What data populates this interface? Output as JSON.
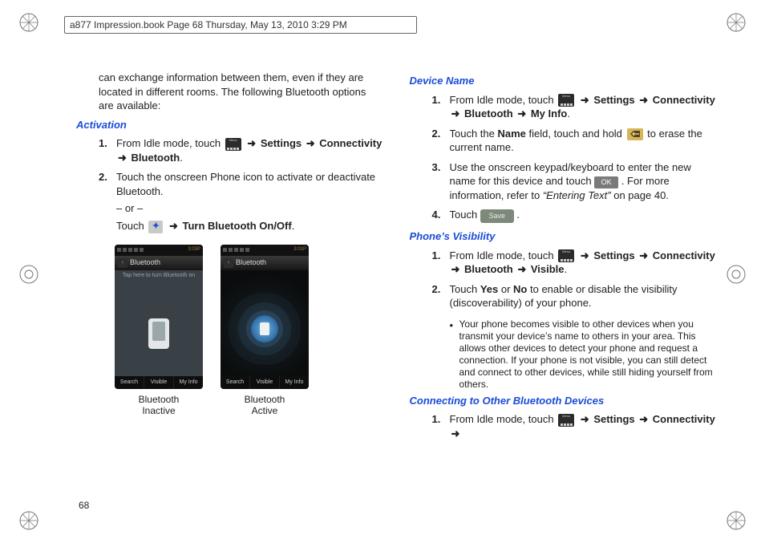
{
  "header": {
    "crop_text": "a877 Impression.book  Page 68  Thursday, May 13, 2010  3:29 PM"
  },
  "page_number": "68",
  "arrow_glyph": "➜",
  "left": {
    "intro": "can exchange information between them, even if they are located in different rooms. The following Bluetooth options are available:",
    "activation_title": "Activation",
    "act_step1_pre": "From Idle mode, touch ",
    "act_step1_seq": [
      "Settings",
      "Connectivity",
      "Bluetooth"
    ],
    "act_step2_l1": "Touch the onscreen Phone icon to activate or deactivate Bluetooth.",
    "act_step2_or": "– or –",
    "act_step2_l3_pre": "Touch ",
    "act_step2_l3_target": "Turn Bluetooth On/Off",
    "phone_status_time": "3:03P",
    "phone_status_time2": "3:01P",
    "phone_title": "Bluetooth",
    "phone_taphint": "Tap here to turn Bluetooth on",
    "softkeys": [
      "Search",
      "Visible",
      "My Info"
    ],
    "caption_inactive_l1": "Bluetooth",
    "caption_inactive_l2": "Inactive",
    "caption_active_l1": "Bluetooth",
    "caption_active_l2": "Active"
  },
  "right": {
    "devname_title": "Device Name",
    "dn_step1_pre": "From Idle mode, touch ",
    "dn_step1_seq": [
      "Settings",
      "Connectivity",
      "Bluetooth",
      "My Info"
    ],
    "dn_step2_a": "Touch the ",
    "dn_step2_name": "Name",
    "dn_step2_b": " field, touch and hold ",
    "dn_step2_c": " to erase the current name.",
    "dn_step3_a": "Use the onscreen keypad/keyboard to enter the new name for this device and touch ",
    "dn_step3_b": ". For more information, refer to ",
    "dn_step3_ref": "“Entering Text”",
    "dn_step3_c": "  on page 40.",
    "dn_step4": "Touch ",
    "ok_label": "OK",
    "save_label": "Save",
    "vis_title": "Phone’s Visibility",
    "vis_step1_pre": "From Idle mode, touch ",
    "vis_step1_seq": [
      "Settings",
      "Connectivity",
      "Bluetooth",
      "Visible"
    ],
    "vis_step2_a": "Touch ",
    "vis_step2_yes": "Yes",
    "vis_step2_or": " or ",
    "vis_step2_no": "No",
    "vis_step2_b": " to enable or disable the visibility (discoverability) of your phone.",
    "vis_bullet": "Your phone becomes visible to other devices when you transmit your device’s name to others in your area. This allows other devices to detect your phone and request a connection. If your phone is not visible, you can still detect and connect to other devices, while still hiding yourself from others.",
    "conn_title": "Connecting to Other Bluetooth Devices",
    "conn_step1_pre": "From Idle mode, touch ",
    "conn_step1_seq": [
      "Settings",
      "Connectivity"
    ]
  }
}
